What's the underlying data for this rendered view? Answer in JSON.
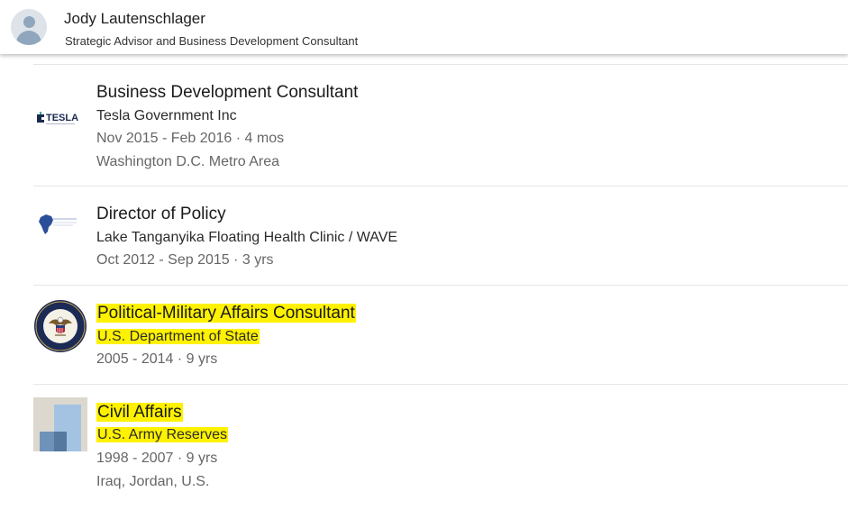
{
  "header": {
    "name": "Jody Lautenschlager",
    "headline": "Strategic Advisor and Business Development Consultant"
  },
  "experience": [
    {
      "logo": "tesla-government-logo",
      "logo_text": "TESLA",
      "title": "Business Development Consultant",
      "company": "Tesla Government Inc",
      "dates": "Nov 2015 - Feb 2016 · 4 mos",
      "location": "Washington D.C. Metro Area"
    },
    {
      "logo": "africa-map-logo",
      "title": "Director of Policy",
      "company": "Lake Tanganyika Floating Health Clinic / WAVE",
      "dates": "Oct 2012 - Sep 2015 · 3 yrs"
    },
    {
      "logo": "department-of-state-seal",
      "title": "Political-Military Affairs Consultant",
      "company": "U.S. Department of State",
      "dates": "2005 - 2014 · 9 yrs",
      "highlighted": true
    },
    {
      "logo": "generic-company-logo",
      "title": "Civil Affairs",
      "company": "U.S. Army Reserves",
      "dates": "1998 - 2007 · 9 yrs",
      "location": "Iraq, Jordan, U.S.",
      "highlighted": true
    }
  ],
  "colors": {
    "highlight": "#fff200",
    "background": "#f3f2ef",
    "card": "#ffffff"
  }
}
